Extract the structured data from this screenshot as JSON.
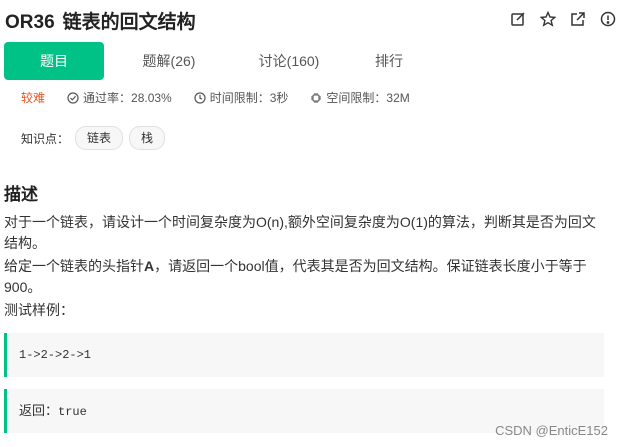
{
  "header": {
    "code": "OR36",
    "title": "链表的回文结构",
    "icons": [
      "edit-icon",
      "star-icon",
      "share-icon",
      "info-icon"
    ]
  },
  "tabs": [
    {
      "label": "题目",
      "active": true
    },
    {
      "label": "题解(26)",
      "active": false
    },
    {
      "label": "讨论(160)",
      "active": false
    },
    {
      "label": "排行",
      "active": false
    }
  ],
  "meta": {
    "difficulty": "较难",
    "pass_rate": "通过率：28.03%",
    "time_limit": "时间限制：3秒",
    "space_limit": "空间限制：32M"
  },
  "knowledge": {
    "label": "知识点：",
    "tags": [
      "链表",
      "栈"
    ]
  },
  "description": {
    "heading": "描述",
    "p1": "对于一个链表，请设计一个时间复杂度为O(n),额外空间复杂度为O(1)的算法，判断其是否为回文结构。",
    "p2_prefix": "给定一个链表的头指针",
    "p2_bold": "A",
    "p2_suffix": "，请返回一个bool值，代表其是否为回文结构。保证链表长度小于等于900。",
    "p3": "测试样例："
  },
  "example": {
    "input": "1->2->2->1",
    "return_label": "返回：",
    "return_value": "true"
  },
  "colors": {
    "accent": "#00c287",
    "difficulty": "#e8541e"
  },
  "watermark": "CSDN @EnticE152"
}
